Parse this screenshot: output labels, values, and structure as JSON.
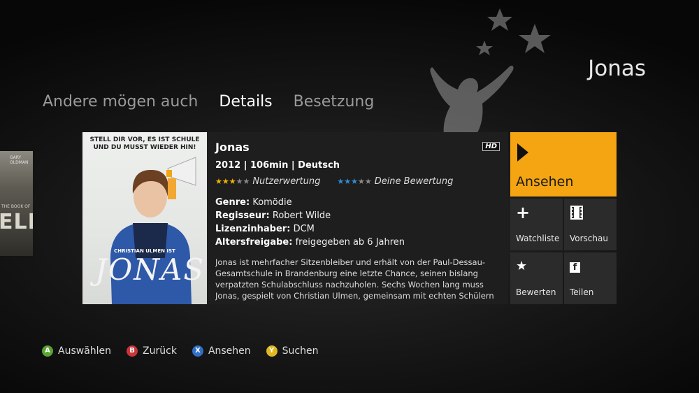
{
  "page": {
    "title": "Jonas"
  },
  "tabs": [
    {
      "label": "Andere mögen auch"
    },
    {
      "label": "Details",
      "active": true
    },
    {
      "label": "Besetzung"
    }
  ],
  "neighbor_poster": {
    "top": "GARY OLDMAN",
    "small": "THE BOOK OF",
    "big": "ELI"
  },
  "poster": {
    "headline": "STELL DIR VOR, ES IST SCHULE UND DU MUSST WIEDER HIN!",
    "actor": "CHRISTIAN ULMEN IST",
    "title": "JONAS"
  },
  "movie": {
    "title": "Jonas",
    "meta": "2012  |  106min  |  Deutsch",
    "badge": "HD",
    "user_rating_label": "Nutzerwertung",
    "user_rating_stars": 3,
    "own_rating_label": "Deine Bewertung",
    "own_rating_stars": 3,
    "genre_label": "Genre:",
    "genre": "Komödie",
    "director_label": "Regisseur:",
    "director": "Robert Wilde",
    "licensor_label": "Lizenzinhaber:",
    "licensor": "DCM",
    "age_label": "Altersfreigabe:",
    "age": "freigegeben ab 6 Jahren",
    "description": "Jonas ist mehrfacher Sitzenbleiber und erhält von der Paul-Dessau-Gesamtschule in Brandenburg eine letzte Chance, seinen bislang verpatzten Schulabschluss nachzuholen. Sechs Wochen lang muss Jonas, gespielt von Christian Ulmen, gemeinsam mit echten Schülern und"
  },
  "actions": {
    "watch": "Ansehen",
    "watchlist": "Watchliste",
    "preview": "Vorschau",
    "rate": "Bewerten",
    "share": "Teilen"
  },
  "footer": [
    {
      "key": "A",
      "label": "Auswählen",
      "color": "#5aa232"
    },
    {
      "key": "B",
      "label": "Zurück",
      "color": "#c8363a"
    },
    {
      "key": "X",
      "label": "Ansehen",
      "color": "#2f6fc4"
    },
    {
      "key": "Y",
      "label": "Suchen",
      "color": "#e0b820"
    }
  ],
  "colors": {
    "accent": "#f4a511",
    "tile": "#2b2b2b",
    "user_star": "#f2b400",
    "own_star": "#2f8fd8"
  }
}
